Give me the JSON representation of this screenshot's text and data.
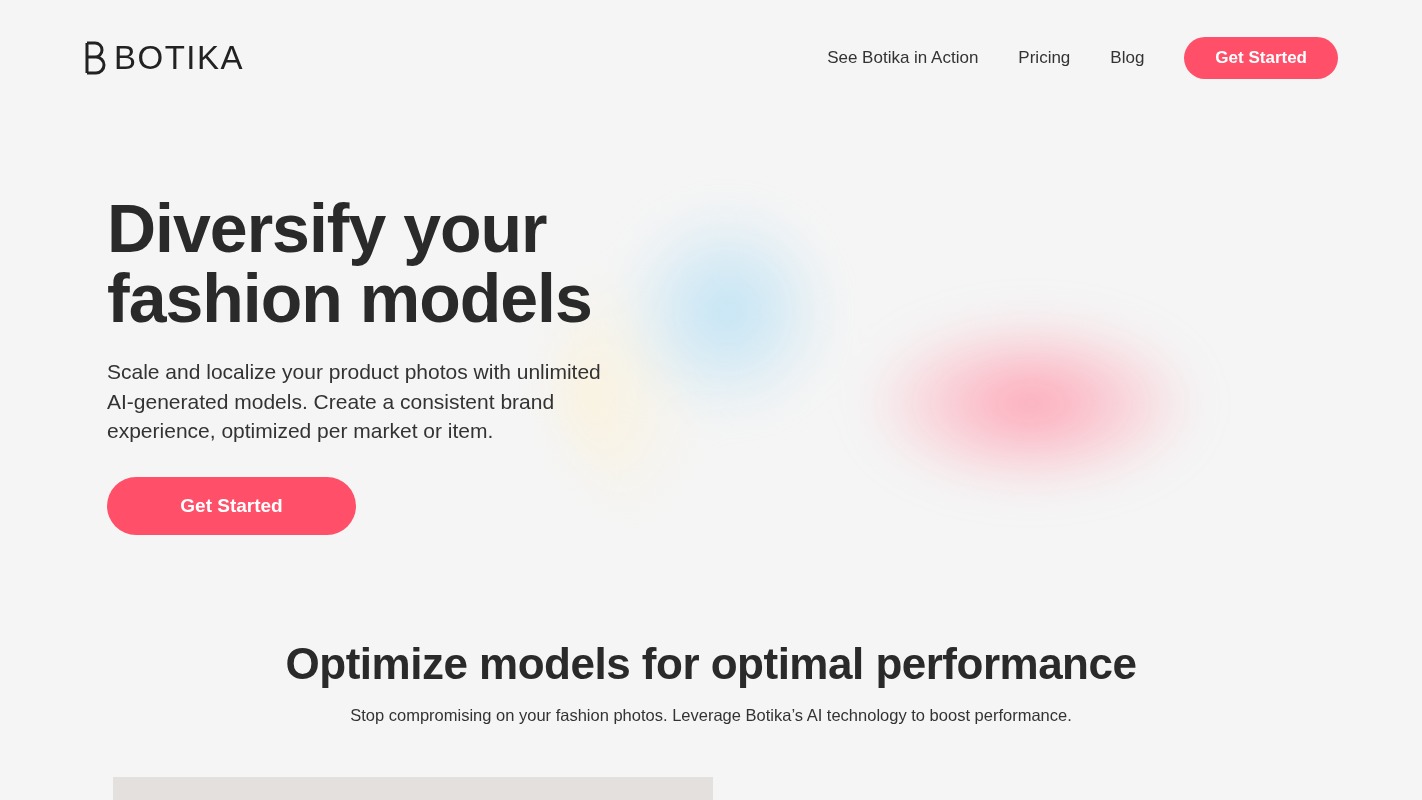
{
  "header": {
    "logo": "BOTIKA",
    "nav": [
      "See Botika in Action",
      "Pricing",
      "Blog"
    ],
    "cta": "Get Started"
  },
  "hero": {
    "title_lines": [
      "Diversify your",
      "fashion models"
    ],
    "subtitle": "Scale and localize your product photos with unlimited AI-generated models. Create a consistent brand experience, optimized per market or item.",
    "cta": "Get Started"
  },
  "section": {
    "title": "Optimize models for optimal performance",
    "subtitle": "Stop compromising on your fashion photos. Leverage Botika’s AI technology to boost performance."
  }
}
